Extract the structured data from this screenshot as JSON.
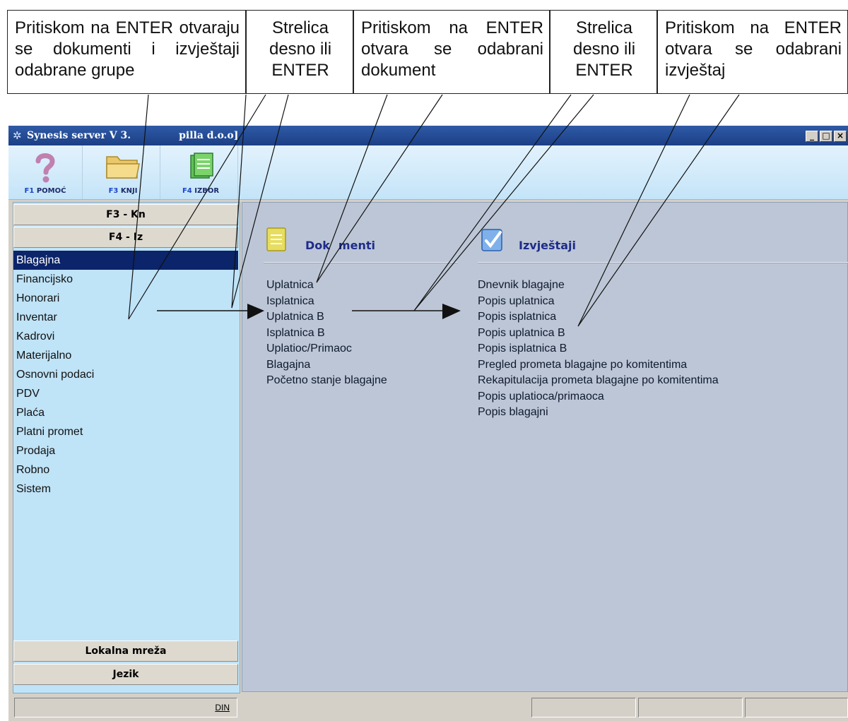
{
  "callouts": [
    "Pritiskom na ENTER otvaraju se dokumenti i izvještaji odabrane grupe",
    "Strelica desno ili ENTER",
    "Pritiskom na ENTER otvara se odabrani dokument",
    "Strelica desno ili ENTER",
    "Pritiskom na ENTER otvara se odabrani izvještaj"
  ],
  "window": {
    "title": "Synesis server V 3.",
    "title_tail": "pilla d.o.o]",
    "buttons": {
      "minimize": "_",
      "maximize": "□",
      "close": "×"
    }
  },
  "toolbar": {
    "help": {
      "key": "F1",
      "label": "POMOĆ",
      "icon": "question-mark-icon"
    },
    "book": {
      "key": "F3",
      "label": "KNJI",
      "icon": "folder-icon"
    },
    "select": {
      "key": "F4",
      "label": "IZBOR",
      "icon": "document-icon"
    }
  },
  "left": {
    "head1": "F3 - Kn",
    "head2": "F4 - Iz",
    "groups": [
      "Blagajna",
      "Financijsko",
      "Honorari",
      "Inventar",
      "Kadrovi",
      "Materijalno",
      "Osnovni podaci",
      "PDV",
      "Plaća",
      "Platni promet",
      "Prodaja",
      "Robno",
      "Sistem"
    ],
    "selected_group": "Blagajna",
    "head3": "Lokalna mreža",
    "head4": "Jezik"
  },
  "documents": {
    "title": "Dok",
    "title_tail": "menti",
    "icon": "document-icon",
    "items": [
      "Uplatnica",
      "Isplatnica",
      "Uplatnica B",
      "Isplatnica B",
      "Uplatioc/Primaoc",
      "Blagajna",
      "Početno stanje blagajne"
    ]
  },
  "reports": {
    "title": "Izvještaji",
    "icon": "checklist-icon",
    "items": [
      "Dnevnik blagajne",
      "Popis uplatnica",
      "Popis isplatnica",
      "Popis uplatnica B",
      "Popis isplatnica B",
      "Pregled prometa blagajne po komitentima",
      "Rekapitulacija prometa blagajne po komitentima",
      "Popis uplatioca/primaoca",
      "Popis blagajni"
    ]
  },
  "status": {
    "currency": "DIN"
  },
  "colors": {
    "title_bar": "#1c3f86",
    "selection": "#0b246a",
    "left_bg": "#bfe3f7",
    "right_bg": "#bcc6d6",
    "heading_text": "#1e2c8a"
  }
}
